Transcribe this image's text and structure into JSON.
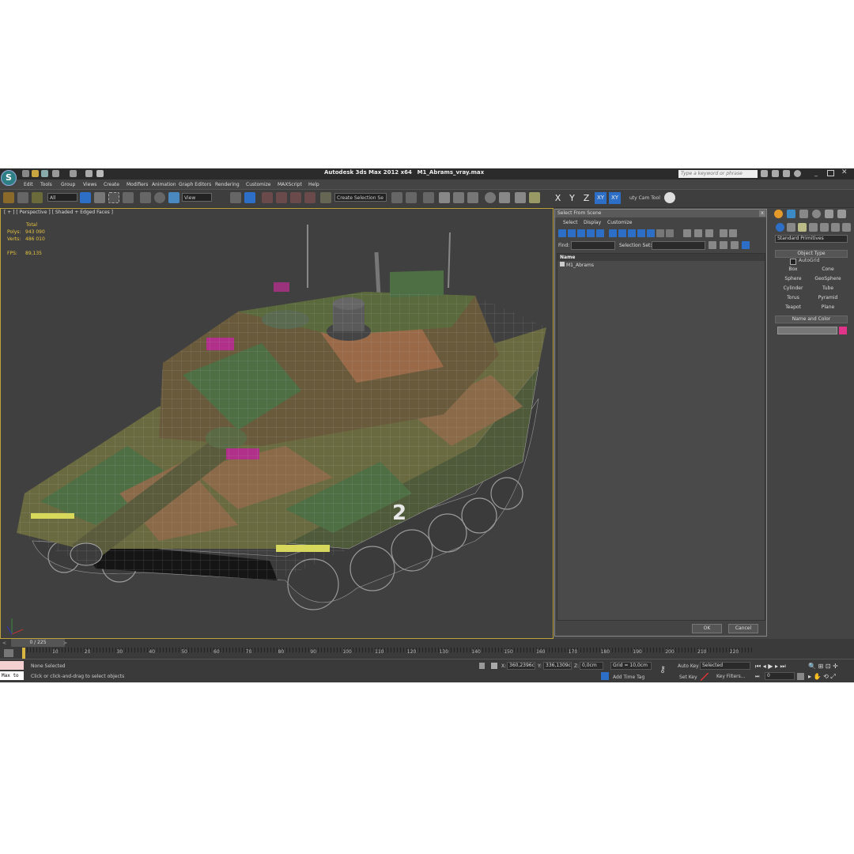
{
  "app": {
    "title_name": "Autodesk 3ds Max  2012 x64",
    "file_name": "M1_Abrams_vray.max",
    "search_placeholder": "Type a keyword or phrase"
  },
  "menu": [
    "Edit",
    "Tools",
    "Group",
    "Views",
    "Create",
    "Modifiers",
    "Animation",
    "Graph Editors",
    "Rendering",
    "Customize",
    "MAXScript",
    "Help"
  ],
  "toolbar": {
    "selection_filter": "All",
    "ref_coord": "View",
    "named_selection": "Create Selection Se",
    "axis_x": "X",
    "axis_y": "Y",
    "axis_z": "Z",
    "axis_xy": "XY",
    "axis_xy2": "XY",
    "cam_tool": "uty Cam Tool"
  },
  "viewport": {
    "label": "[ + ] [ Perspective ] [ Shaded + Edged Faces ]",
    "stats": {
      "total_label": "Total",
      "polys_label": "Polys:",
      "polys": "943 090",
      "verts_label": "Verts:",
      "verts": "486 010",
      "fps_label": "FPS:",
      "fps": "89,135"
    },
    "hull_number": "2"
  },
  "dialog": {
    "title": "Select From Scene",
    "close": "x",
    "menus": [
      "Select",
      "Display",
      "Customize"
    ],
    "find_label": "Find:",
    "selection_set_label": "Selection Set:",
    "column_name": "Name",
    "items": [
      "M1_Abrams"
    ],
    "ok": "OK",
    "cancel": "Cancel"
  },
  "command_panel": {
    "category": "Standard Primitives",
    "object_type": "Object Type",
    "autogrid": "AutoGrid",
    "buttons": [
      "Box",
      "Cone",
      "Sphere",
      "GeoSphere",
      "Cylinder",
      "Tube",
      "Torus",
      "Pyramid",
      "Teapot",
      "Plane"
    ],
    "name_and_color": "Name and Color",
    "object_color": "#e0338a"
  },
  "timeline": {
    "frame_counter": "0 / 225",
    "ticks": [
      "10",
      "20",
      "30",
      "40",
      "50",
      "60",
      "70",
      "80",
      "90",
      "100",
      "110",
      "120",
      "130",
      "140",
      "150",
      "160",
      "170",
      "180",
      "190",
      "200",
      "210",
      "220"
    ]
  },
  "status": {
    "listener": "Max to",
    "selection": "None Selected",
    "prompt": "Click or click-and-drag to select objects",
    "x_label": "X:",
    "x_value": "360,2396c",
    "y_label": "Y:",
    "y_value": "336,1309c",
    "z_label": "Z:",
    "z_value": "0,0cm",
    "grid": "Grid = 10,0cm",
    "add_time_tag": "Add Time Tag",
    "auto_key": "Auto Key",
    "set_key": "Set Key",
    "key_mode": "Selected",
    "key_filters": "Key Filters...",
    "current_frame": "0"
  }
}
